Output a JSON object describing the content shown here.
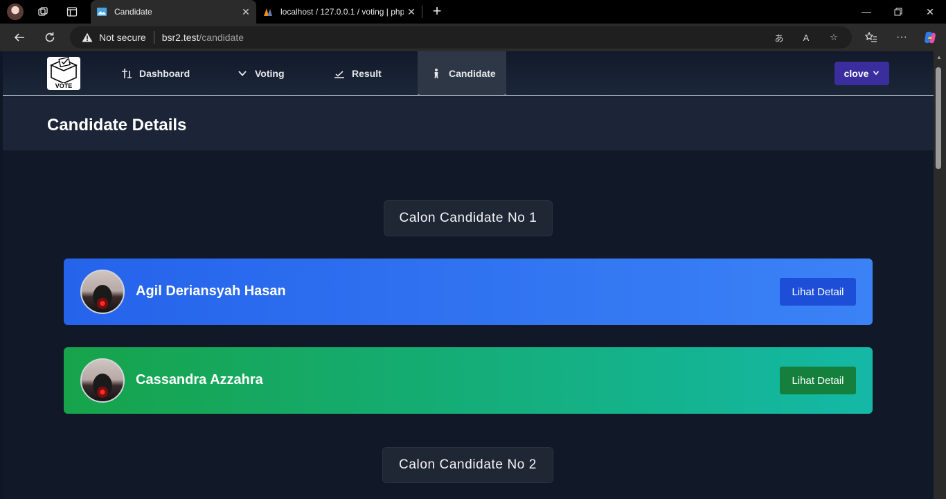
{
  "browser": {
    "tabs": [
      {
        "title": "Candidate",
        "active": true
      },
      {
        "title": "localhost / 127.0.0.1 / voting | php",
        "active": false
      }
    ],
    "security_label": "Not secure",
    "url_host": "bsr2.test",
    "url_path": "/candidate"
  },
  "app": {
    "logo_text": "VOTE",
    "nav": [
      {
        "label": "Dashboard",
        "icon": "dashboard-icon"
      },
      {
        "label": "Voting",
        "icon": "chevron-down-icon"
      },
      {
        "label": "Result",
        "icon": "check-icon"
      },
      {
        "label": "Candidate",
        "icon": "person-icon",
        "active": true
      }
    ],
    "user": {
      "name": "clove"
    },
    "page_title": "Candidate Details",
    "sections": [
      {
        "label": "Calon Candidate No 1",
        "candidates": [
          {
            "name": "Agil Deriansyah Hasan",
            "button": "Lihat Detail",
            "color": "#2563eb"
          },
          {
            "name": "Cassandra Azzahra",
            "button": "Lihat Detail",
            "color": "#16a34a"
          }
        ]
      },
      {
        "label": "Calon Candidate No 2",
        "candidates": []
      }
    ]
  }
}
